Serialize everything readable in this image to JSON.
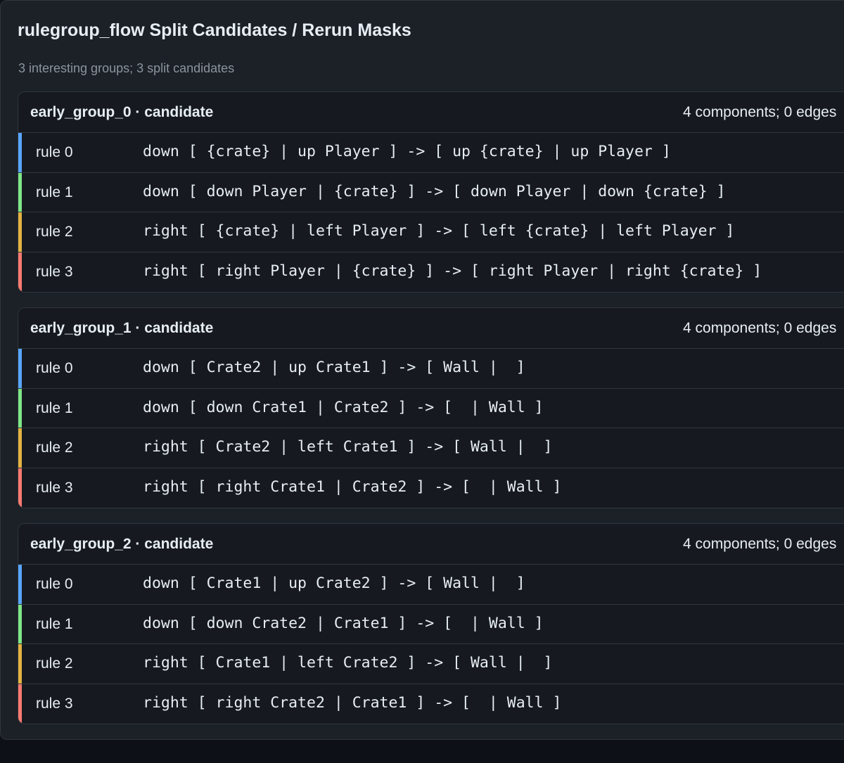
{
  "panel": {
    "title": "rulegroup_flow Split Candidates / Rerun Masks",
    "summary": "3 interesting groups; 3 split candidates"
  },
  "colors": {
    "bar_0": "#58a6ff",
    "bar_1": "#7ee787",
    "bar_2": "#e3b341",
    "bar_3": "#ff7b72"
  },
  "groups": [
    {
      "name": "early_group_0 · candidate",
      "meta": "4 components; 0 edges",
      "rules": [
        {
          "label": "rule 0",
          "text": "down [ {crate} | up Player ] -> [ up {crate} | up Player ]"
        },
        {
          "label": "rule 1",
          "text": "down [ down Player | {crate} ] -> [ down Player | down {crate} ]"
        },
        {
          "label": "rule 2",
          "text": "right [ {crate} | left Player ] -> [ left {crate} | left Player ]"
        },
        {
          "label": "rule 3",
          "text": "right [ right Player | {crate} ] -> [ right Player | right {crate} ]"
        }
      ]
    },
    {
      "name": "early_group_1 · candidate",
      "meta": "4 components; 0 edges",
      "rules": [
        {
          "label": "rule 0",
          "text": "down [ Crate2 | up Crate1 ] -> [ Wall |  ]"
        },
        {
          "label": "rule 1",
          "text": "down [ down Crate1 | Crate2 ] -> [  | Wall ]"
        },
        {
          "label": "rule 2",
          "text": "right [ Crate2 | left Crate1 ] -> [ Wall |  ]"
        },
        {
          "label": "rule 3",
          "text": "right [ right Crate1 | Crate2 ] -> [  | Wall ]"
        }
      ]
    },
    {
      "name": "early_group_2 · candidate",
      "meta": "4 components; 0 edges",
      "rules": [
        {
          "label": "rule 0",
          "text": "down [ Crate1 | up Crate2 ] -> [ Wall |  ]"
        },
        {
          "label": "rule 1",
          "text": "down [ down Crate2 | Crate1 ] -> [  | Wall ]"
        },
        {
          "label": "rule 2",
          "text": "right [ Crate1 | left Crate2 ] -> [ Wall |  ]"
        },
        {
          "label": "rule 3",
          "text": "right [ right Crate2 | Crate1 ] -> [  | Wall ]"
        }
      ]
    }
  ]
}
